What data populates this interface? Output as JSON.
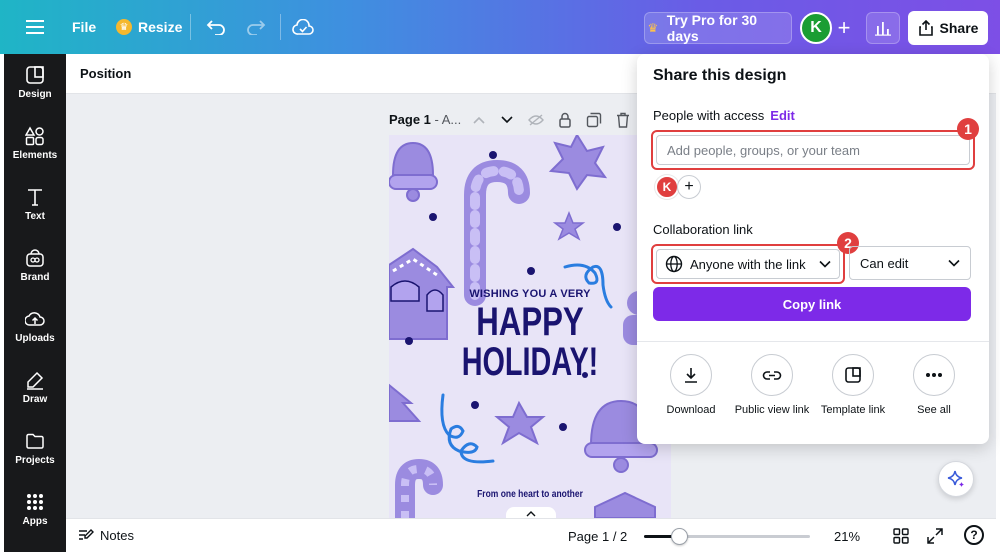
{
  "topbar": {
    "file_label": "File",
    "resize_label": "Resize",
    "try_pro_label": "Try Pro for 30 days",
    "avatar_initial": "K",
    "share_label": "Share"
  },
  "sidebar": {
    "items": [
      {
        "label": "Design",
        "icon": "design-icon"
      },
      {
        "label": "Elements",
        "icon": "elements-icon"
      },
      {
        "label": "Text",
        "icon": "text-icon"
      },
      {
        "label": "Brand",
        "icon": "brand-icon"
      },
      {
        "label": "Uploads",
        "icon": "uploads-icon"
      },
      {
        "label": "Draw",
        "icon": "draw-icon"
      },
      {
        "label": "Projects",
        "icon": "projects-icon"
      },
      {
        "label": "Apps",
        "icon": "apps-icon"
      }
    ]
  },
  "context_bar": {
    "position_label": "Position"
  },
  "canvas": {
    "page_label_strong": "Page 1",
    "page_label_rest": " - A...",
    "design": {
      "wish_text": "WISHING YOU A VERY",
      "happy_text": "HAPPY",
      "holiday_text": "HOLIDAY!",
      "from_text": "From one heart to another"
    }
  },
  "bottombar": {
    "notes_label": "Notes",
    "page_count": "Page 1 / 2",
    "zoom_percent": "21%",
    "zoom_fraction": 0.21,
    "help_label": "?"
  },
  "share_panel": {
    "title": "Share this design",
    "people_label": "People with access",
    "edit_label": "Edit",
    "input_placeholder": "Add people, groups, or your team",
    "member_initial": "K",
    "collab_label": "Collaboration link",
    "access_value": "Anyone with the link",
    "permission_value": "Can edit",
    "copy_link_label": "Copy link",
    "options": [
      {
        "label": "Download",
        "icon": "download-icon"
      },
      {
        "label": "Public view link",
        "icon": "link-icon"
      },
      {
        "label": "Template link",
        "icon": "template-icon"
      },
      {
        "label": "See all",
        "icon": "more-icon"
      }
    ],
    "badge_1": "1",
    "badge_2": "2"
  },
  "colors": {
    "accent_purple": "#7d2ae8",
    "highlight_red": "#e03f3f",
    "avatar_green": "#1a9d33"
  }
}
